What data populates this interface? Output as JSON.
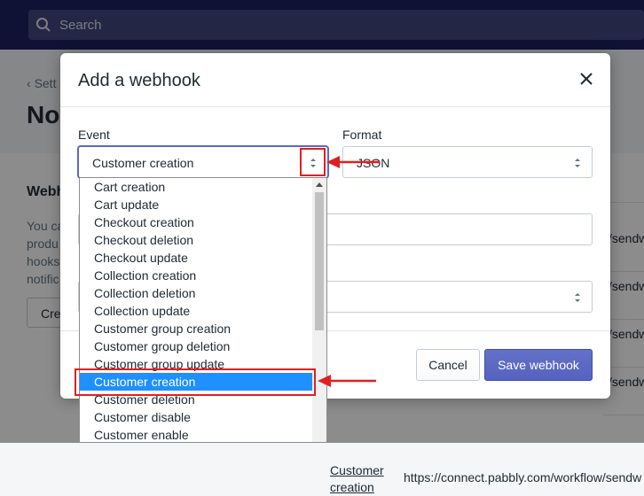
{
  "topbar": {
    "search_placeholder": "Search"
  },
  "background": {
    "back_link": "Sett",
    "title": "No",
    "card_title": "Webh",
    "card_text": [
      "You ca",
      "produ",
      "hooks",
      "notific"
    ],
    "create_button": "Cre",
    "url_fragments": [
      "/sendw",
      "/sendw",
      "/sendw",
      "/sendw"
    ],
    "row_event_link": [
      "Customer",
      "creation"
    ],
    "row_url": "https://connect.pabbly.com/workflow/sendw"
  },
  "modal": {
    "title": "Add a webhook",
    "event_label": "Event",
    "event_value": "Customer creation",
    "format_label": "Format",
    "format_value": "JSON",
    "cancel_label": "Cancel",
    "save_label": "Save webhook"
  },
  "dropdown": {
    "options": [
      "Cart creation",
      "Cart update",
      "Checkout creation",
      "Checkout deletion",
      "Checkout update",
      "Collection creation",
      "Collection deletion",
      "Collection update",
      "Customer group creation",
      "Customer group deletion",
      "Customer group update",
      "Customer creation",
      "Customer deletion",
      "Customer disable",
      "Customer enable"
    ],
    "selected": "Customer creation"
  },
  "colors": {
    "topbar": "#1c2260",
    "primary": "#5c6ac4",
    "selection": "#1e90ff",
    "annotation": "#e02020"
  }
}
